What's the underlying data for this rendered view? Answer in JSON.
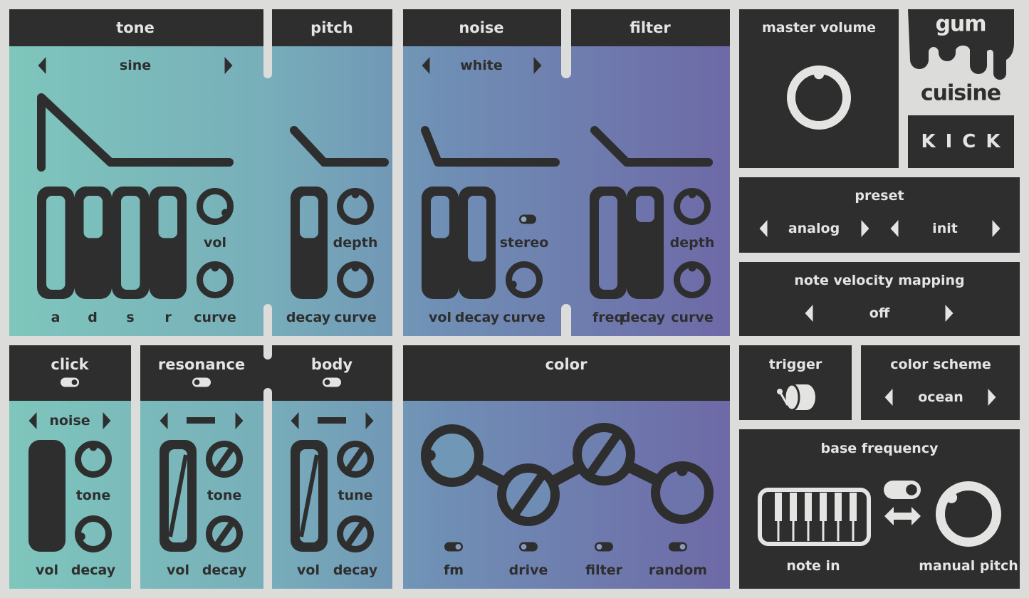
{
  "colors": {
    "dark": "#2e2e2e",
    "light": "#e4e4e2",
    "gradient_left": "#7ec6bc",
    "gradient_right": "#6e69a7"
  },
  "tone": {
    "title": "tone",
    "waveform": "sine",
    "labels": {
      "a": "a",
      "d": "d",
      "s": "s",
      "r": "r",
      "vol": "vol",
      "curve": "curve"
    },
    "sliders": {
      "a": 0,
      "d": 0.55,
      "s": 0,
      "r": 0.55
    },
    "knobs": {
      "vol": 0.95,
      "curve": 0.5
    }
  },
  "pitch": {
    "title": "pitch",
    "labels": {
      "decay": "decay",
      "depth": "depth",
      "curve": "curve"
    },
    "sliders": {
      "decay": 0.55
    },
    "knobs": {
      "depth": 0.5,
      "curve": 0.5
    }
  },
  "noise": {
    "title": "noise",
    "type": "white",
    "labels": {
      "vol": "vol",
      "decay": "decay",
      "stereo": "stereo",
      "curve": "curve"
    },
    "sliders": {
      "vol": 0.55,
      "decay": 0.3
    },
    "stereo_on": false,
    "knobs": {
      "curve": 0.08
    }
  },
  "filter": {
    "title": "filter",
    "labels": {
      "freq": "freq",
      "decay": "decay",
      "depth": "depth",
      "curve": "curve"
    },
    "sliders": {
      "freq": 0,
      "decay": 0.72
    },
    "knobs": {
      "depth": 0.5,
      "curve": 0.5
    }
  },
  "click": {
    "title": "click",
    "enabled": true,
    "type": "noise",
    "labels": {
      "vol": "vol",
      "tone": "tone",
      "decay": "decay"
    },
    "sliders": {
      "vol": 1
    },
    "knobs": {
      "tone": 0.5,
      "decay": 0.12
    }
  },
  "resonance": {
    "title": "resonance",
    "enabled": false,
    "type": "—",
    "labels": {
      "vol": "vol",
      "tone": "tone",
      "decay": "decay"
    }
  },
  "body": {
    "title": "body",
    "enabled": false,
    "type": "—",
    "labels": {
      "vol": "vol",
      "tune": "tune",
      "decay": "decay"
    }
  },
  "color": {
    "title": "color",
    "items": [
      {
        "label": "fm",
        "enabled": true,
        "value": 0.17
      },
      {
        "label": "drive",
        "enabled": false
      },
      {
        "label": "filter",
        "enabled": false
      },
      {
        "label": "random",
        "enabled": true,
        "value": 0.5
      }
    ]
  },
  "master_volume": {
    "label": "master volume",
    "value": 0.5
  },
  "logo": {
    "top": "gum",
    "bottom": "cuisine",
    "product": "KICK"
  },
  "preset": {
    "label": "preset",
    "bank": "analog",
    "name": "init"
  },
  "velocity": {
    "label": "note velocity mapping",
    "value": "off"
  },
  "trigger": {
    "label": "trigger"
  },
  "color_scheme": {
    "label": "color scheme",
    "value": "ocean"
  },
  "base_frequency": {
    "label": "base frequency",
    "note_in": "note in",
    "manual_pitch": "manual pitch",
    "mode_manual": true,
    "pitch_value": 0.33
  }
}
